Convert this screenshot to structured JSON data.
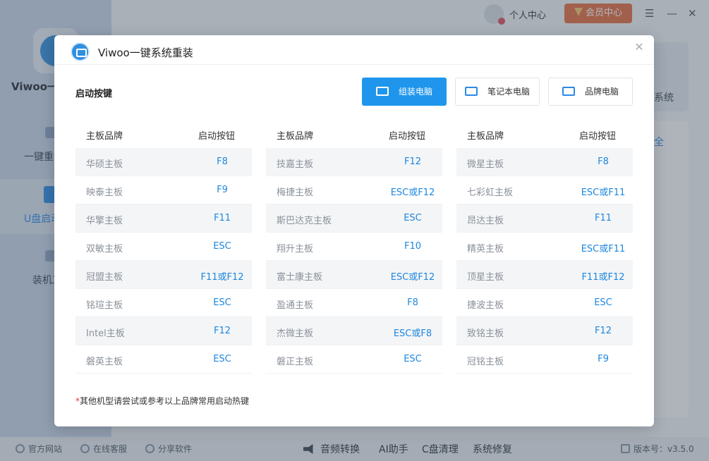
{
  "app": {
    "name": "Viwoo一键",
    "sidebar": [
      {
        "label": "一键重装",
        "active": false
      },
      {
        "label": "U盘启动",
        "active": true
      },
      {
        "label": "装机工具",
        "active": false
      }
    ],
    "user_center": "个人中心",
    "vip_center": "会员中心",
    "bg_text_1": "系统",
    "bg_text_2": "全"
  },
  "footer": {
    "links": [
      "官方网站",
      "在线客服",
      "分享软件"
    ],
    "tools": [
      "音频转换",
      "AI助手",
      "C盘清理",
      "系统修复"
    ],
    "version": "版本号：v3.5.0"
  },
  "dialog": {
    "title": "Viwoo一键系统重装",
    "section_title": "启动按键",
    "tabs": [
      {
        "label": "组装电脑",
        "icon": "desktop-icon",
        "active": true
      },
      {
        "label": "笔记本电脑",
        "icon": "laptop-icon",
        "active": false
      },
      {
        "label": "品牌电脑",
        "icon": "monitor-icon",
        "active": false
      }
    ],
    "columns_header": {
      "brand": "主板品牌",
      "key": "启动按钮"
    },
    "columns": [
      [
        {
          "brand": "华硕主板",
          "key": "F8"
        },
        {
          "brand": "映泰主板",
          "key": "F9"
        },
        {
          "brand": "华擎主板",
          "key": "F11"
        },
        {
          "brand": "双敏主板",
          "key": "ESC"
        },
        {
          "brand": "冠盟主板",
          "key": "F11或F12"
        },
        {
          "brand": "铭瑄主板",
          "key": "ESC"
        },
        {
          "brand": "Intel主板",
          "key": "F12"
        },
        {
          "brand": "磐英主板",
          "key": "ESC"
        }
      ],
      [
        {
          "brand": "技嘉主板",
          "key": "F12"
        },
        {
          "brand": "梅捷主板",
          "key": "ESC或F12"
        },
        {
          "brand": "斯巴达克主板",
          "key": "ESC"
        },
        {
          "brand": "翔升主板",
          "key": "F10"
        },
        {
          "brand": "富士康主板",
          "key": "ESC或F12"
        },
        {
          "brand": "盈通主板",
          "key": "F8"
        },
        {
          "brand": "杰微主板",
          "key": "ESC或F8"
        },
        {
          "brand": "磐正主板",
          "key": "ESC"
        }
      ],
      [
        {
          "brand": "微星主板",
          "key": "F8"
        },
        {
          "brand": "七彩虹主板",
          "key": "ESC或F11"
        },
        {
          "brand": "昂达主板",
          "key": "F11"
        },
        {
          "brand": "精英主板",
          "key": "ESC或F11"
        },
        {
          "brand": "顶星主板",
          "key": "F11或F12"
        },
        {
          "brand": "捷波主板",
          "key": "ESC"
        },
        {
          "brand": "致铭主板",
          "key": "F12"
        },
        {
          "brand": "冠铭主板",
          "key": "F9"
        }
      ]
    ],
    "note_star": "*",
    "note": "其他机型请尝试或参考以上品牌常用启动热键"
  },
  "colors": {
    "accent": "#1f96ec",
    "key_text": "#1d87de",
    "vip": "#e46b3e"
  }
}
